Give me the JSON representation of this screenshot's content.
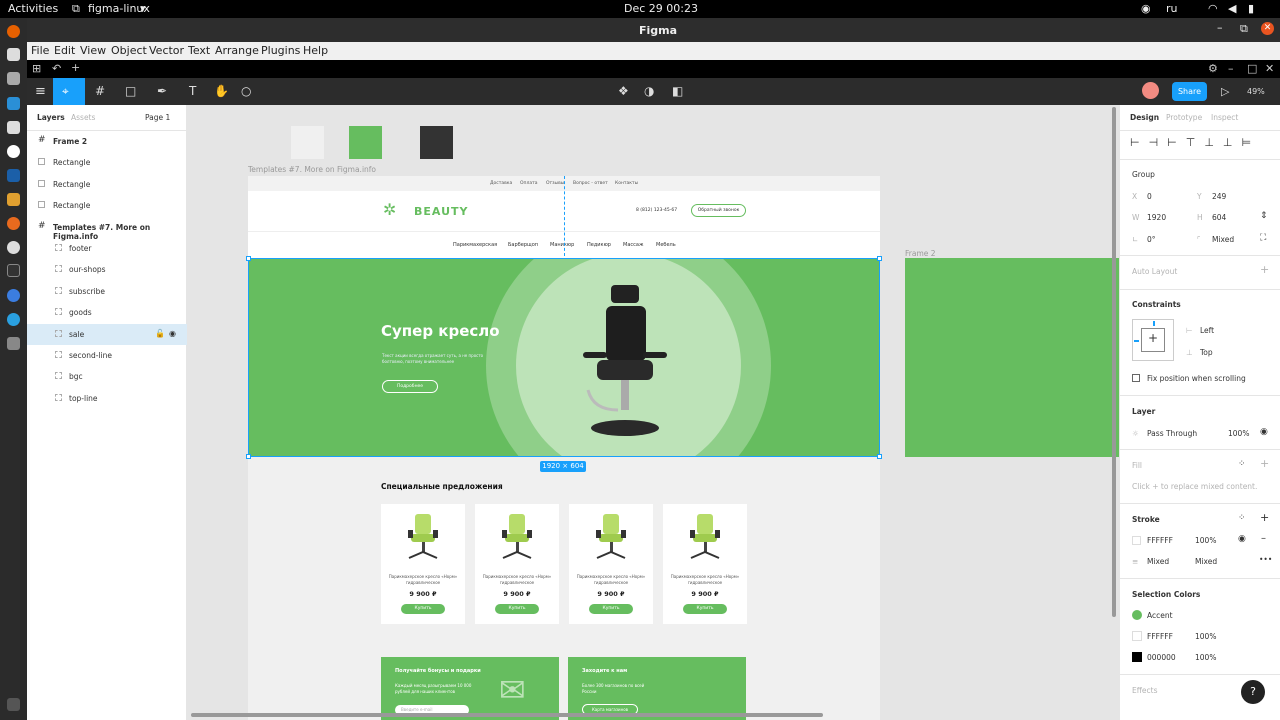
{
  "gnome": {
    "activities": "Activities",
    "app_name": "figma-linux",
    "datetime": "Dec 29  00:23",
    "lang": "ru"
  },
  "window": {
    "title": "Figma"
  },
  "menu": {
    "items": [
      "File",
      "Edit",
      "View",
      "Object",
      "Vector",
      "Text",
      "Arrange",
      "Plugins",
      "Help"
    ]
  },
  "toolbar": {
    "share_label": "Share",
    "zoom": "49%"
  },
  "layers": {
    "tab_layers": "Layers",
    "tab_assets": "Assets",
    "page": "Page 1",
    "rows": [
      {
        "label": "Frame 2",
        "bold": true,
        "indent": 0,
        "icon": "frame"
      },
      {
        "label": "Rectangle",
        "bold": false,
        "indent": 0,
        "icon": "rect"
      },
      {
        "label": "Rectangle",
        "bold": false,
        "indent": 0,
        "icon": "rect"
      },
      {
        "label": "Rectangle",
        "bold": false,
        "indent": 0,
        "icon": "rect"
      },
      {
        "label": "Templates #7. More on Figma.info",
        "bold": true,
        "indent": 0,
        "icon": "frame"
      },
      {
        "label": "footer",
        "bold": false,
        "indent": 1,
        "icon": "group"
      },
      {
        "label": "our-shops",
        "bold": false,
        "indent": 1,
        "icon": "group"
      },
      {
        "label": "subscribe",
        "bold": false,
        "indent": 1,
        "icon": "group"
      },
      {
        "label": "goods",
        "bold": false,
        "indent": 1,
        "icon": "group"
      },
      {
        "label": "sale",
        "bold": false,
        "indent": 1,
        "icon": "group",
        "selected": true
      },
      {
        "label": "second-line",
        "bold": false,
        "indent": 1,
        "icon": "group"
      },
      {
        "label": "bgc",
        "bold": false,
        "indent": 1,
        "icon": "group"
      },
      {
        "label": "top-line",
        "bold": false,
        "indent": 1,
        "icon": "group"
      }
    ]
  },
  "canvas": {
    "frame_label": "Templates #7. More on Figma.info",
    "frame2_label": "Frame 2",
    "size_badge": "1920 × 604",
    "site": {
      "top_links": [
        "Доставка",
        "Оплата",
        "Отзывы",
        "Вопрос - ответ",
        "Контакты"
      ],
      "logo": "BEAUTY",
      "phone": "8 (812) 123-45-67",
      "callback": "Обратный звонок",
      "nav": [
        "Парикмахерская",
        "Барберщоп",
        "Маникюр",
        "Педикюр",
        "Массаж",
        "Мебель"
      ],
      "hero_title": "Супер кресло",
      "hero_text": "Текст акции всегда отражает суть, а не просто болтовню, поэтому внимательнее",
      "hero_button": "Подробнее",
      "offers_title": "Специальные предложения",
      "products": [
        {
          "name": "Парикмахерское кресло «Норм» гидравлическое",
          "price": "9 900 ₽",
          "button": "Купить"
        },
        {
          "name": "Парикмахерское кресло «Норм» гидравлическое",
          "price": "9 900 ₽",
          "button": "Купить"
        },
        {
          "name": "Парикмахерское кресло «Норм» гидравлическое",
          "price": "9 900 ₽",
          "button": "Купить"
        },
        {
          "name": "Парикмахерское кресло «Норм» гидравлическое",
          "price": "9 900 ₽",
          "button": "Купить"
        }
      ],
      "promo1_title": "Получайте бонусы и подарки",
      "promo1_text": "Каждый месяц разыгрываем 10 000 рублей для наших клиентов",
      "promo1_input": "Введите e-mail",
      "promo2_title": "Заходите к нам",
      "promo2_text": "Более 300 магазинов по всей России",
      "promo2_button": "Карта магазинов"
    }
  },
  "props": {
    "tabs": [
      "Design",
      "Prototype",
      "Inspect"
    ],
    "group_label": "Group",
    "x": "0",
    "y": "249",
    "w": "1920",
    "h": "604",
    "rotation": "0°",
    "radius": "Mixed",
    "auto_layout": "Auto Layout",
    "constraints": "Constraints",
    "constraint_h": "Left",
    "constraint_v": "Top",
    "fix_position": "Fix position when scrolling",
    "layer": "Layer",
    "blend": "Pass Through",
    "opacity": "100%",
    "fill": "Fill",
    "fill_hint": "Click + to replace mixed content.",
    "stroke": "Stroke",
    "stroke_color": "FFFFFF",
    "stroke_opacity": "100%",
    "stroke_mixed": "Mixed",
    "stroke_mixed2": "Mixed",
    "selection_colors": "Selection Colors",
    "sel": [
      {
        "name": "Accent",
        "value": "",
        "color": "#66bd5f"
      },
      {
        "name": "FFFFFF",
        "value": "100%",
        "color": "#ffffff"
      },
      {
        "name": "000000",
        "value": "100%",
        "color": "#000000"
      }
    ],
    "effects": "Effects",
    "help": "?"
  },
  "colors": {
    "accent": "#66bd5f",
    "figma_blue": "#18a0fb"
  }
}
